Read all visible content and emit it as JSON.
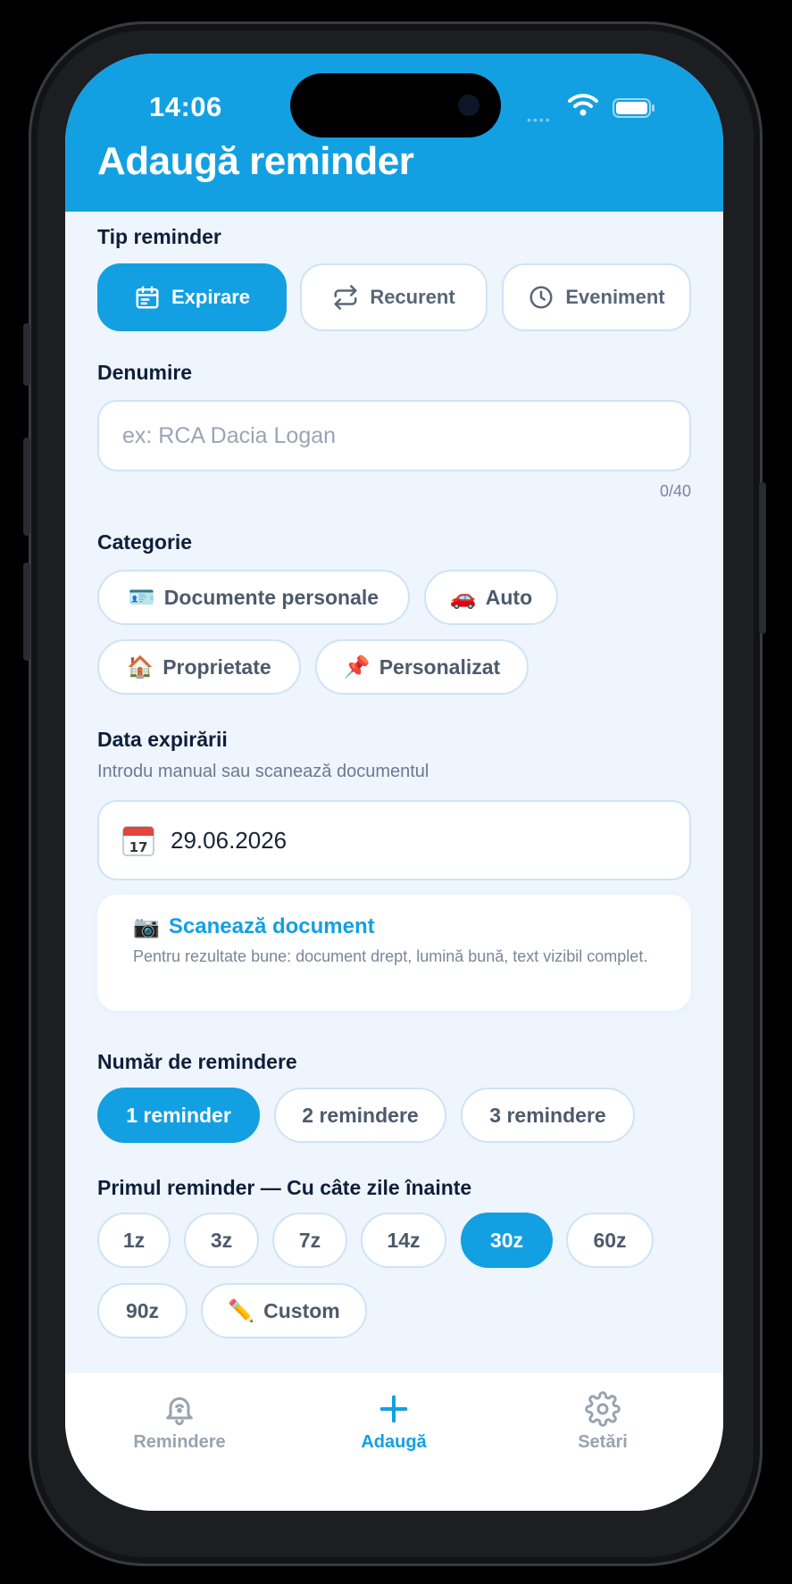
{
  "status_bar": {
    "time": "14:06"
  },
  "header": {
    "title": "Adaugă reminder"
  },
  "reminder_type": {
    "label": "Tip reminder",
    "options": [
      {
        "label": "Expirare",
        "icon": "calendar-icon",
        "active": true
      },
      {
        "label": "Recurent",
        "icon": "repeat-icon",
        "active": false
      },
      {
        "label": "Eveniment",
        "icon": "clock-icon",
        "active": false
      }
    ]
  },
  "name": {
    "label": "Denumire",
    "placeholder": "ex: RCA Dacia Logan",
    "value": "",
    "char_count": "0/40"
  },
  "category": {
    "label": "Categorie",
    "options": [
      {
        "emoji": "🪪",
        "label": "Documente personale"
      },
      {
        "emoji": "🚗",
        "label": "Auto"
      },
      {
        "emoji": "🏠",
        "label": "Proprietate"
      },
      {
        "emoji": "📌",
        "label": "Personalizat"
      }
    ]
  },
  "expiry": {
    "label": "Data expirării",
    "hint": "Introdu manual sau scanează documentul",
    "calendar_day": "17",
    "value": "29.06.2026"
  },
  "scan": {
    "emoji": "📷",
    "title": "Scanează document",
    "description": "Pentru rezultate bune: document drept, lumină bună, text vizibil complet."
  },
  "reminder_count": {
    "label": "Număr de remindere",
    "options": [
      {
        "label": "1 reminder",
        "active": true
      },
      {
        "label": "2 remindere",
        "active": false
      },
      {
        "label": "3 remindere",
        "active": false
      }
    ]
  },
  "first_reminder": {
    "label": "Primul reminder — Cu câte zile înainte",
    "options": [
      {
        "label": "1z",
        "active": false
      },
      {
        "label": "3z",
        "active": false
      },
      {
        "label": "7z",
        "active": false
      },
      {
        "label": "14z",
        "active": false
      },
      {
        "label": "30z",
        "active": true
      },
      {
        "label": "60z",
        "active": false
      },
      {
        "label": "90z",
        "active": false
      },
      {
        "label": "Custom",
        "emoji": "✏️",
        "active": false
      }
    ]
  },
  "tabbar": {
    "items": [
      {
        "label": "Remindere",
        "icon": "bell-icon",
        "active": false
      },
      {
        "label": "Adaugă",
        "icon": "plus-icon",
        "active": true
      },
      {
        "label": "Setări",
        "icon": "gear-icon",
        "active": false
      }
    ]
  },
  "colors": {
    "primary": "#13a0e2",
    "background": "#eef5fd",
    "text_dark": "#0f1e3a",
    "text_muted": "#7a8698"
  }
}
